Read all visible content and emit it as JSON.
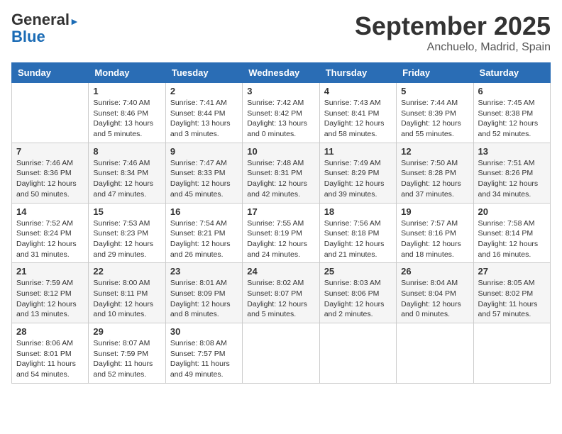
{
  "header": {
    "logo_general": "General",
    "logo_blue": "Blue",
    "month_title": "September 2025",
    "location": "Anchuelo, Madrid, Spain"
  },
  "days_of_week": [
    "Sunday",
    "Monday",
    "Tuesday",
    "Wednesday",
    "Thursday",
    "Friday",
    "Saturday"
  ],
  "weeks": [
    [
      {
        "day": "",
        "info": ""
      },
      {
        "day": "1",
        "info": "Sunrise: 7:40 AM\nSunset: 8:46 PM\nDaylight: 13 hours\nand 5 minutes."
      },
      {
        "day": "2",
        "info": "Sunrise: 7:41 AM\nSunset: 8:44 PM\nDaylight: 13 hours\nand 3 minutes."
      },
      {
        "day": "3",
        "info": "Sunrise: 7:42 AM\nSunset: 8:42 PM\nDaylight: 13 hours\nand 0 minutes."
      },
      {
        "day": "4",
        "info": "Sunrise: 7:43 AM\nSunset: 8:41 PM\nDaylight: 12 hours\nand 58 minutes."
      },
      {
        "day": "5",
        "info": "Sunrise: 7:44 AM\nSunset: 8:39 PM\nDaylight: 12 hours\nand 55 minutes."
      },
      {
        "day": "6",
        "info": "Sunrise: 7:45 AM\nSunset: 8:38 PM\nDaylight: 12 hours\nand 52 minutes."
      }
    ],
    [
      {
        "day": "7",
        "info": "Sunrise: 7:46 AM\nSunset: 8:36 PM\nDaylight: 12 hours\nand 50 minutes."
      },
      {
        "day": "8",
        "info": "Sunrise: 7:46 AM\nSunset: 8:34 PM\nDaylight: 12 hours\nand 47 minutes."
      },
      {
        "day": "9",
        "info": "Sunrise: 7:47 AM\nSunset: 8:33 PM\nDaylight: 12 hours\nand 45 minutes."
      },
      {
        "day": "10",
        "info": "Sunrise: 7:48 AM\nSunset: 8:31 PM\nDaylight: 12 hours\nand 42 minutes."
      },
      {
        "day": "11",
        "info": "Sunrise: 7:49 AM\nSunset: 8:29 PM\nDaylight: 12 hours\nand 39 minutes."
      },
      {
        "day": "12",
        "info": "Sunrise: 7:50 AM\nSunset: 8:28 PM\nDaylight: 12 hours\nand 37 minutes."
      },
      {
        "day": "13",
        "info": "Sunrise: 7:51 AM\nSunset: 8:26 PM\nDaylight: 12 hours\nand 34 minutes."
      }
    ],
    [
      {
        "day": "14",
        "info": "Sunrise: 7:52 AM\nSunset: 8:24 PM\nDaylight: 12 hours\nand 31 minutes."
      },
      {
        "day": "15",
        "info": "Sunrise: 7:53 AM\nSunset: 8:23 PM\nDaylight: 12 hours\nand 29 minutes."
      },
      {
        "day": "16",
        "info": "Sunrise: 7:54 AM\nSunset: 8:21 PM\nDaylight: 12 hours\nand 26 minutes."
      },
      {
        "day": "17",
        "info": "Sunrise: 7:55 AM\nSunset: 8:19 PM\nDaylight: 12 hours\nand 24 minutes."
      },
      {
        "day": "18",
        "info": "Sunrise: 7:56 AM\nSunset: 8:18 PM\nDaylight: 12 hours\nand 21 minutes."
      },
      {
        "day": "19",
        "info": "Sunrise: 7:57 AM\nSunset: 8:16 PM\nDaylight: 12 hours\nand 18 minutes."
      },
      {
        "day": "20",
        "info": "Sunrise: 7:58 AM\nSunset: 8:14 PM\nDaylight: 12 hours\nand 16 minutes."
      }
    ],
    [
      {
        "day": "21",
        "info": "Sunrise: 7:59 AM\nSunset: 8:12 PM\nDaylight: 12 hours\nand 13 minutes."
      },
      {
        "day": "22",
        "info": "Sunrise: 8:00 AM\nSunset: 8:11 PM\nDaylight: 12 hours\nand 10 minutes."
      },
      {
        "day": "23",
        "info": "Sunrise: 8:01 AM\nSunset: 8:09 PM\nDaylight: 12 hours\nand 8 minutes."
      },
      {
        "day": "24",
        "info": "Sunrise: 8:02 AM\nSunset: 8:07 PM\nDaylight: 12 hours\nand 5 minutes."
      },
      {
        "day": "25",
        "info": "Sunrise: 8:03 AM\nSunset: 8:06 PM\nDaylight: 12 hours\nand 2 minutes."
      },
      {
        "day": "26",
        "info": "Sunrise: 8:04 AM\nSunset: 8:04 PM\nDaylight: 12 hours\nand 0 minutes."
      },
      {
        "day": "27",
        "info": "Sunrise: 8:05 AM\nSunset: 8:02 PM\nDaylight: 11 hours\nand 57 minutes."
      }
    ],
    [
      {
        "day": "28",
        "info": "Sunrise: 8:06 AM\nSunset: 8:01 PM\nDaylight: 11 hours\nand 54 minutes."
      },
      {
        "day": "29",
        "info": "Sunrise: 8:07 AM\nSunset: 7:59 PM\nDaylight: 11 hours\nand 52 minutes."
      },
      {
        "day": "30",
        "info": "Sunrise: 8:08 AM\nSunset: 7:57 PM\nDaylight: 11 hours\nand 49 minutes."
      },
      {
        "day": "",
        "info": ""
      },
      {
        "day": "",
        "info": ""
      },
      {
        "day": "",
        "info": ""
      },
      {
        "day": "",
        "info": ""
      }
    ]
  ]
}
